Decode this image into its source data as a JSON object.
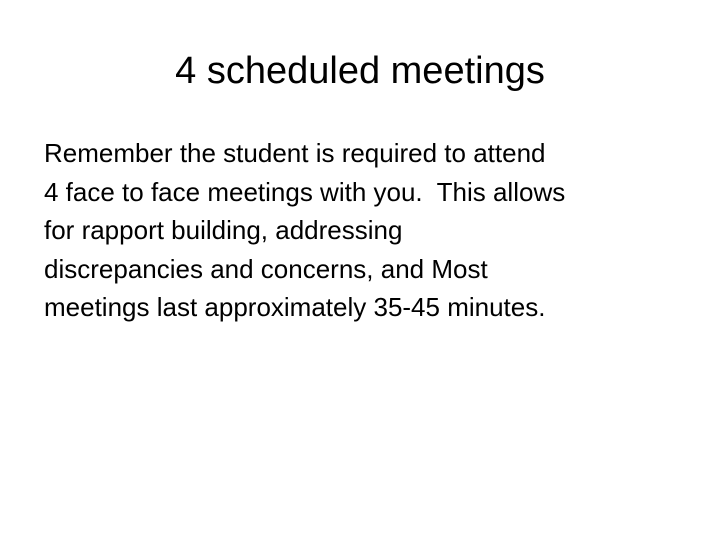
{
  "slide": {
    "title": "4 scheduled meetings",
    "body_lines": [
      "Remember the student is required to attend",
      "4 face to face meetings with you.  This allows",
      "for rapport building, addressing",
      "discrepancies and concerns, and Most",
      "meetings last approximately 35-45 minutes."
    ]
  }
}
